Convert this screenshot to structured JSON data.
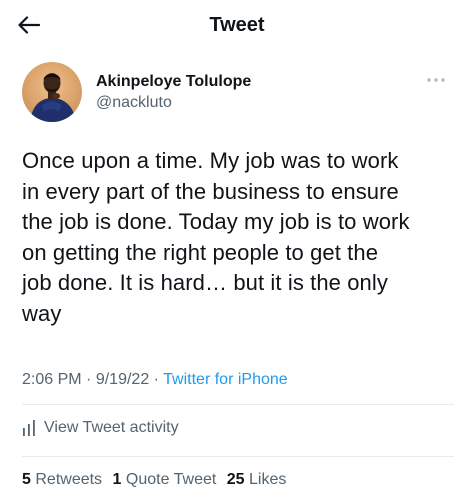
{
  "header": {
    "title": "Tweet",
    "back_icon": "arrow-left-icon"
  },
  "author": {
    "display_name": "Akinpeloye Tolulope",
    "handle": "@nackluto",
    "more_icon": "more-dots-icon"
  },
  "tweet": {
    "lines": [
      "Once upon a time. My job was to work",
      "in every part of the business to ensure",
      "the job is done. Today my job is to work",
      "on getting the right people to get the",
      "job done. It is hard… but it is the only",
      "way"
    ],
    "time": "2:06 PM",
    "date": "9/19/22",
    "separator": "·",
    "source": "Twitter for iPhone"
  },
  "activity": {
    "label": "View Tweet activity",
    "icon": "activity-bars-icon"
  },
  "stats": {
    "retweets_count": "5",
    "retweets_label": "Retweets",
    "quotes_count": "1",
    "quotes_label": "Quote Tweet",
    "likes_count": "25",
    "likes_label": "Likes"
  },
  "colors": {
    "text_primary": "#0f1419",
    "text_secondary": "#536471",
    "link": "#1d9bf0",
    "divider": "#e6ecf0"
  }
}
